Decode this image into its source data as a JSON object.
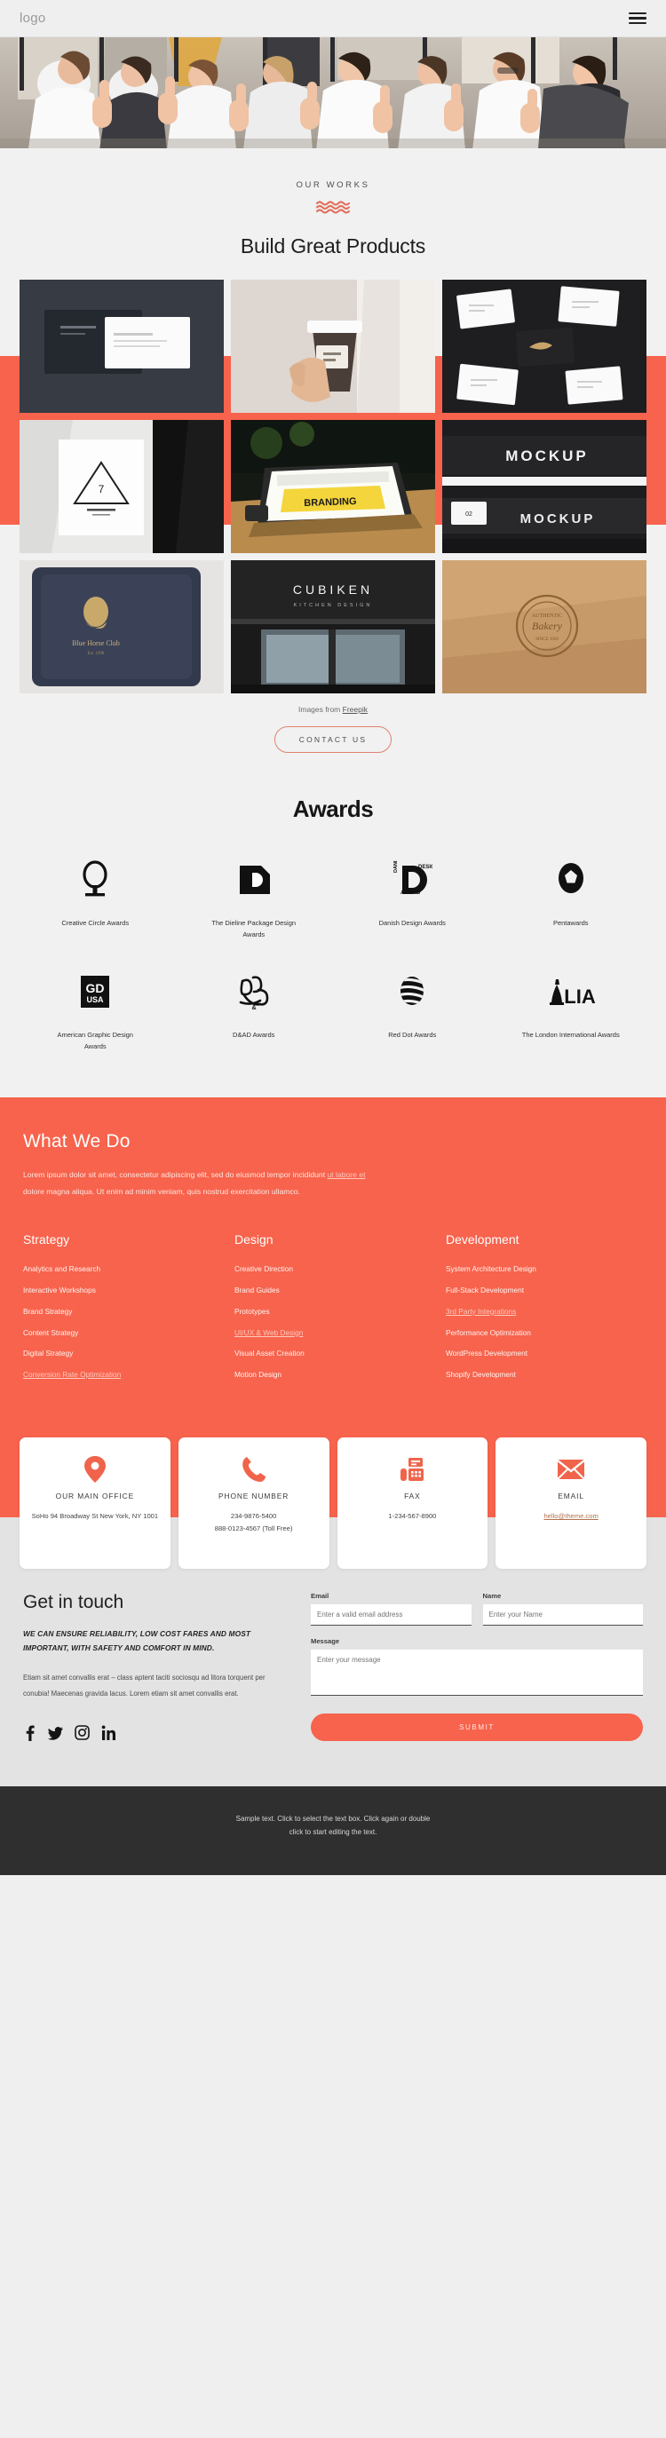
{
  "header": {
    "logo": "logo",
    "menu_icon": "hamburger-icon"
  },
  "hero": {
    "alt": "business team giving thumbs up"
  },
  "works": {
    "eyebrow": "OUR WORKS",
    "title": "Build Great Products",
    "credit_prefix": "Images from ",
    "credit_link": "Freepik",
    "cta": "CONTACT US",
    "tiles": [
      {
        "name": "black-business-card-stationery"
      },
      {
        "name": "hand-holding-coffee-cup"
      },
      {
        "name": "scattered-business-cards-dark"
      },
      {
        "name": "triangle-logo-poster-mockup"
      },
      {
        "name": "laptop-branding-presentation"
      },
      {
        "name": "dark-mockup-banner-cards"
      },
      {
        "name": "navy-leather-notebook-logo"
      },
      {
        "name": "cubiken-kitchen-design-storefront"
      },
      {
        "name": "kraft-paper-embossed-stamp"
      }
    ]
  },
  "awards": {
    "title": "Awards",
    "items": [
      {
        "logo": "creative-circle-awards-logo",
        "name": "Creative Circle Awards"
      },
      {
        "logo": "the-dieline-awards-logo",
        "name": "The Dieline Package Design Awards"
      },
      {
        "logo": "danish-design-awards-logo",
        "name": "Danish Design Awards"
      },
      {
        "logo": "pentawards-logo",
        "name": "Pentawards"
      },
      {
        "logo": "gd-usa-logo",
        "name": "American Graphic Design Awards"
      },
      {
        "logo": "dad-awards-logo",
        "name": "D&AD Awards"
      },
      {
        "logo": "red-dot-awards-logo",
        "name": "Red Dot Awards"
      },
      {
        "logo": "lia-logo",
        "name": "The London International Awards"
      }
    ]
  },
  "what_we_do": {
    "title": "What We Do",
    "para_1": "Lorem ipsum dolor sit amet, consectetur adipiscing elit, sed do eiusmod tempor incididunt ",
    "para_link": "ut labore et",
    "para_2": " dolore magna aliqua. Ut enim ad minim veniam, quis nostrud exercitation ullamco.",
    "columns": [
      {
        "heading": "Strategy",
        "items": [
          {
            "label": "Analytics and Research",
            "link": false
          },
          {
            "label": "Interactive Workshops",
            "link": false
          },
          {
            "label": "Brand Strategy",
            "link": false
          },
          {
            "label": "Content Strategy",
            "link": false
          },
          {
            "label": "Digital Strategy",
            "link": false
          },
          {
            "label": "Conversion Rate Optimization",
            "link": true
          }
        ]
      },
      {
        "heading": "Design",
        "items": [
          {
            "label": "Creative Direction",
            "link": false
          },
          {
            "label": "Brand Guides",
            "link": false
          },
          {
            "label": "Prototypes",
            "link": false
          },
          {
            "label": "UI/UX & Web Design",
            "link": true
          },
          {
            "label": "Visual Asset Creation",
            "link": false
          },
          {
            "label": "Motion Design",
            "link": false
          }
        ]
      },
      {
        "heading": "Development",
        "items": [
          {
            "label": "System Architecture Design",
            "link": false
          },
          {
            "label": "Full-Stack Development",
            "link": false
          },
          {
            "label": "3rd Party Integrations",
            "link": true
          },
          {
            "label": "Performance Optimization",
            "link": false
          },
          {
            "label": "WordPress Development",
            "link": false
          },
          {
            "label": "Shopify Development",
            "link": false
          }
        ]
      }
    ]
  },
  "contact_cards": [
    {
      "icon": "map-pin-icon",
      "title": "OUR MAIN OFFICE",
      "value": "SoHo 94 Broadway St New York, NY 1001",
      "value_2": "",
      "is_link": false
    },
    {
      "icon": "phone-icon",
      "title": "PHONE NUMBER",
      "value": "234-9876-5400",
      "value_2": "888-0123-4567 (Toll Free)",
      "is_link": false
    },
    {
      "icon": "fax-icon",
      "title": "FAX",
      "value": "1-234-567-8900",
      "value_2": "",
      "is_link": false
    },
    {
      "icon": "envelope-icon",
      "title": "EMAIL",
      "value": "hello@theme.com",
      "value_2": "",
      "is_link": true
    }
  ],
  "get_in_touch": {
    "title": "Get in touch",
    "lead": "WE CAN ENSURE RELIABILITY, LOW COST FARES AND MOST IMPORTANT, WITH SAFETY AND COMFORT IN MIND.",
    "body": "Etiam sit amet convallis erat – class aptent taciti sociosqu ad litora torquent per conubia! Maecenas gravida lacus. Lorem etiam sit amet convallis erat.",
    "socials": [
      {
        "name": "facebook-icon"
      },
      {
        "name": "twitter-icon"
      },
      {
        "name": "instagram-icon"
      },
      {
        "name": "linkedin-icon"
      }
    ],
    "form": {
      "email_label": "Email",
      "email_placeholder": "Enter a valid email address",
      "email_value": "",
      "name_label": "Name",
      "name_placeholder": "Enter your Name",
      "name_value": "",
      "message_label": "Message",
      "message_placeholder": "Enter your message",
      "message_value": "",
      "submit_label": "SUBMIT"
    }
  },
  "footer": {
    "line_1": "Sample text. Click to select the text box. Click again or double",
    "line_2": "click to start editing the text."
  },
  "colors": {
    "accent": "#f7634c",
    "bg": "#f1f1f1",
    "bg_alt": "#e3e3e3",
    "footer": "#2f2f2f"
  }
}
